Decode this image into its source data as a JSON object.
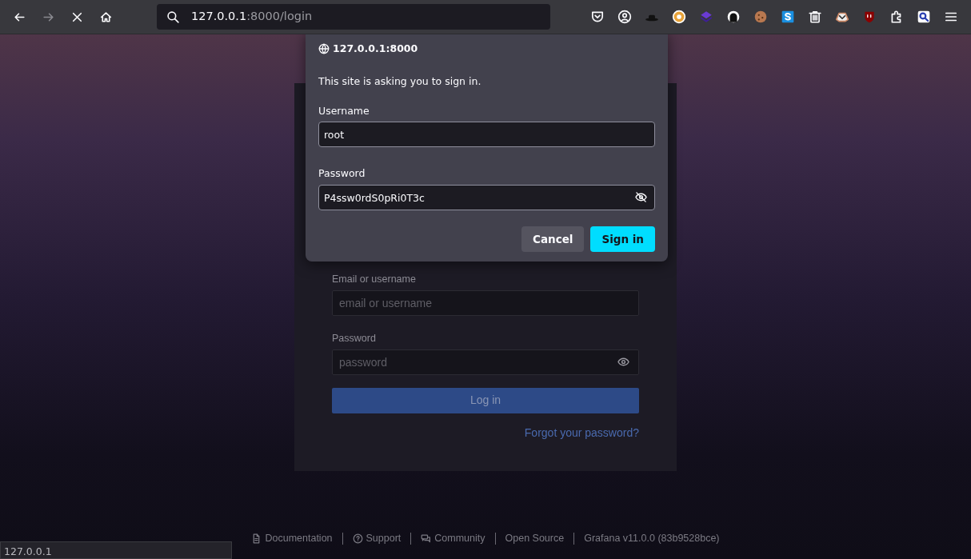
{
  "browser": {
    "nav_buttons": [
      {
        "kind": "back",
        "disabled": false
      },
      {
        "kind": "forward",
        "disabled": true
      },
      {
        "kind": "stop",
        "disabled": false
      },
      {
        "kind": "home",
        "disabled": false
      }
    ],
    "url": {
      "host": "127.0.0.1",
      "rest": ":8000/login"
    }
  },
  "auth_dialog": {
    "origin": "127.0.0.1:8000",
    "message": "This site is asking you to sign in.",
    "fields": [
      {
        "label": "Username",
        "value": "root",
        "kind": "text"
      },
      {
        "label": "Password",
        "value": "P4ssw0rdS0pRi0T3c",
        "kind": "revealed-password"
      }
    ],
    "buttons": [
      {
        "label": "Cancel",
        "primary": false
      },
      {
        "label": "Sign in",
        "primary": true
      }
    ]
  },
  "login_form": {
    "fields": [
      {
        "label": "Email or username",
        "placeholder": "email or username",
        "kind": "text"
      },
      {
        "label": "Password",
        "placeholder": "password",
        "kind": "password"
      }
    ],
    "submit": "Log in",
    "forgot_link": "Forgot your password?"
  },
  "footer": {
    "links": [
      {
        "kind": "document",
        "label": "Documentation"
      },
      {
        "kind": "help",
        "label": "Support"
      },
      {
        "kind": "chat",
        "label": "Community"
      },
      {
        "kind": "plain",
        "label": "Open Source"
      },
      {
        "kind": "plain",
        "label": "Grafana v11.0.0 (83b9528bce)"
      }
    ]
  },
  "status_bar": "127.0.0.1"
}
